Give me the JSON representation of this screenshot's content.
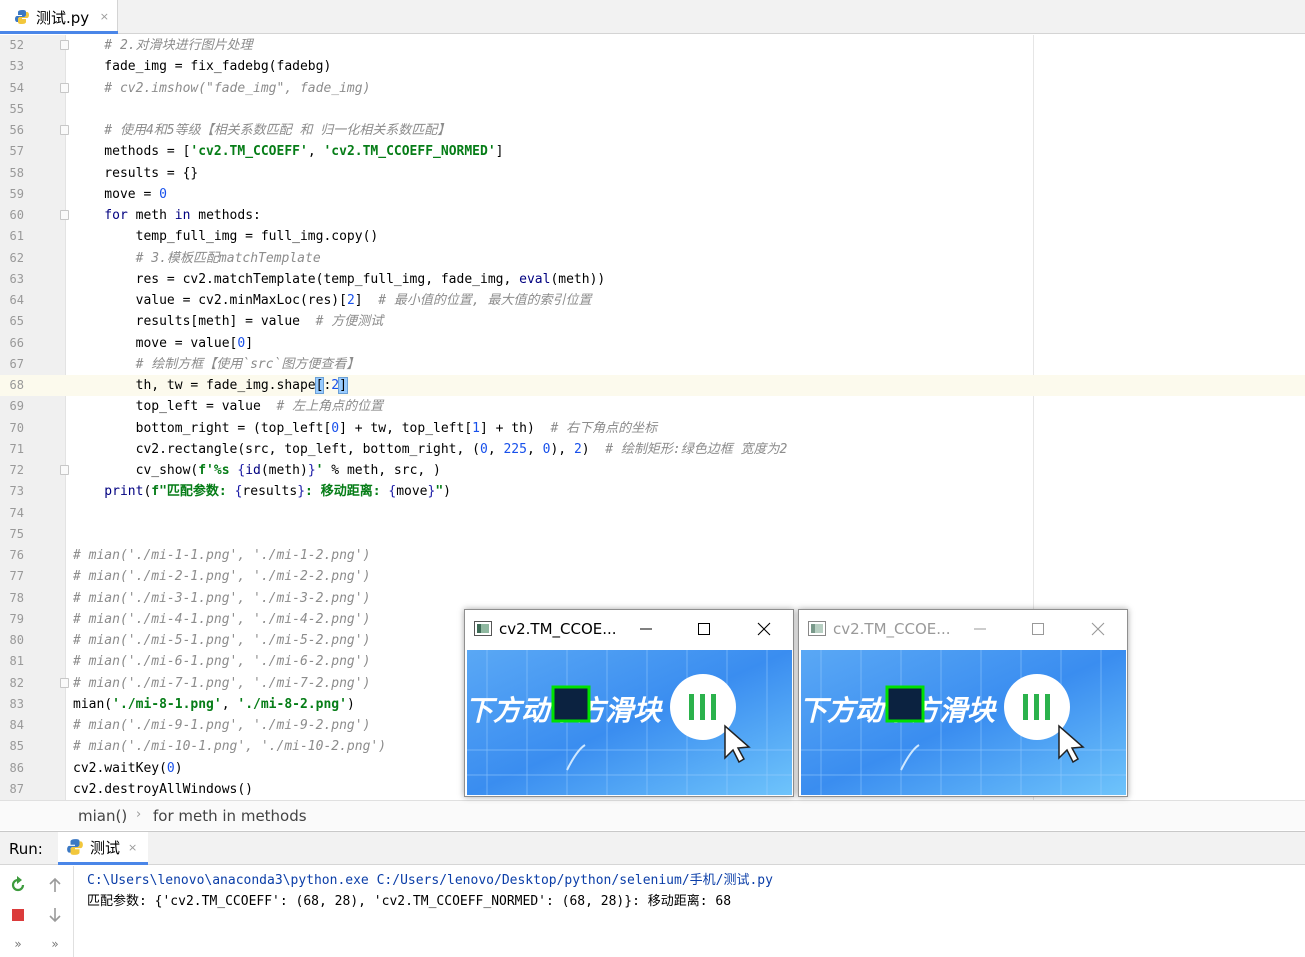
{
  "editor_tab": {
    "label": "测试.py",
    "close": "×"
  },
  "code_lines": [
    {
      "n": "52",
      "segs": [
        [
          "cmt",
          "    # 2.对滑块进行图片处理"
        ]
      ]
    },
    {
      "n": "53",
      "segs": [
        [
          "",
          "    fade_img = fix_fadebg(fadebg)"
        ]
      ]
    },
    {
      "n": "54",
      "segs": [
        [
          "cmt",
          "    # cv2.imshow(\"fade_img\", fade_img)"
        ]
      ]
    },
    {
      "n": "55",
      "segs": [
        [
          "",
          ""
        ]
      ]
    },
    {
      "n": "56",
      "segs": [
        [
          "cmt",
          "    # 使用4和5等级【相关系数匹配 和 归一化相关系数匹配】"
        ]
      ]
    },
    {
      "n": "57",
      "segs": [
        [
          "",
          "    methods = ["
        ],
        [
          "str",
          "'cv2.TM_CCOEFF'"
        ],
        [
          "",
          ", "
        ],
        [
          "str",
          "'cv2.TM_CCOEFF_NORMED'"
        ],
        [
          "",
          "]"
        ]
      ]
    },
    {
      "n": "58",
      "segs": [
        [
          "",
          "    results = {}"
        ]
      ]
    },
    {
      "n": "59",
      "segs": [
        [
          "",
          "    move = "
        ],
        [
          "num",
          "0"
        ]
      ]
    },
    {
      "n": "60",
      "segs": [
        [
          "kw",
          "    for"
        ],
        [
          "",
          " meth "
        ],
        [
          "kw",
          "in"
        ],
        [
          "",
          " methods:"
        ]
      ]
    },
    {
      "n": "61",
      "segs": [
        [
          "",
          "        temp_full_img = full_img.copy()"
        ]
      ]
    },
    {
      "n": "62",
      "segs": [
        [
          "cmt",
          "        # 3.模板匹配matchTemplate"
        ]
      ]
    },
    {
      "n": "63",
      "segs": [
        [
          "",
          "        res = cv2.matchTemplate(temp_full_img, fade_img, "
        ],
        [
          "bi",
          "eval"
        ],
        [
          "",
          "(meth))"
        ]
      ]
    },
    {
      "n": "64",
      "segs": [
        [
          "",
          "        value = cv2.minMaxLoc(res)["
        ],
        [
          "num",
          "2"
        ],
        [
          "",
          "]  "
        ],
        [
          "cmt",
          "# 最小值的位置, 最大值的索引位置"
        ]
      ]
    },
    {
      "n": "65",
      "segs": [
        [
          "",
          "        results[meth] = value  "
        ],
        [
          "cmt",
          "# 方便测试"
        ]
      ]
    },
    {
      "n": "66",
      "segs": [
        [
          "",
          "        move = value["
        ],
        [
          "num",
          "0"
        ],
        [
          "",
          "]"
        ]
      ]
    },
    {
      "n": "67",
      "segs": [
        [
          "cmt",
          "        # 绘制方框【使用`src`图方便查看】"
        ]
      ]
    },
    {
      "n": "68",
      "segs": [
        [
          "",
          "        th, tw = fade_img.shape"
        ],
        [
          "match",
          "["
        ],
        [
          "",
          ":"
        ],
        [
          "num",
          "2"
        ],
        [
          "match",
          "]"
        ]
      ],
      "current": true
    },
    {
      "n": "69",
      "segs": [
        [
          "",
          "        top_left = value  "
        ],
        [
          "cmt",
          "# 左上角点的位置"
        ]
      ]
    },
    {
      "n": "70",
      "segs": [
        [
          "",
          "        bottom_right = (top_left["
        ],
        [
          "num",
          "0"
        ],
        [
          "",
          "] + tw, top_left["
        ],
        [
          "num",
          "1"
        ],
        [
          "",
          "] + th)  "
        ],
        [
          "cmt",
          "# 右下角点的坐标"
        ]
      ]
    },
    {
      "n": "71",
      "segs": [
        [
          "",
          "        cv2.rectangle(src, top_left, bottom_right, ("
        ],
        [
          "num",
          "0"
        ],
        [
          "",
          ", "
        ],
        [
          "num",
          "225"
        ],
        [
          "",
          ", "
        ],
        [
          "num",
          "0"
        ],
        [
          "",
          "), "
        ],
        [
          "num",
          "2"
        ],
        [
          "",
          ")  "
        ],
        [
          "cmt",
          "# 绘制矩形:绿色边框 宽度为2"
        ]
      ]
    },
    {
      "n": "72",
      "segs": [
        [
          "",
          "        cv_show("
        ],
        [
          "fstr",
          "f'%s "
        ],
        [
          "brace",
          "{"
        ],
        [
          "bi",
          "id"
        ],
        [
          "",
          "(meth)"
        ],
        [
          "brace",
          "}"
        ],
        [
          "fstr",
          "'"
        ],
        [
          "",
          " % meth, src, )"
        ]
      ]
    },
    {
      "n": "73",
      "segs": [
        [
          "bi",
          "    print"
        ],
        [
          "",
          "("
        ],
        [
          "fstr",
          "f\"匹配参数: "
        ],
        [
          "brace",
          "{"
        ],
        [
          "",
          "results"
        ],
        [
          "brace",
          "}"
        ],
        [
          "fstr",
          ": 移动距离: "
        ],
        [
          "brace",
          "{"
        ],
        [
          "",
          "move"
        ],
        [
          "brace",
          "}"
        ],
        [
          "fstr",
          "\""
        ],
        [
          "",
          ")"
        ]
      ]
    },
    {
      "n": "74",
      "segs": [
        [
          "",
          ""
        ]
      ]
    },
    {
      "n": "75",
      "segs": [
        [
          "",
          ""
        ]
      ]
    },
    {
      "n": "76",
      "segs": [
        [
          "cmt",
          "# mian('./mi-1-1.png', './mi-1-2.png')"
        ]
      ]
    },
    {
      "n": "77",
      "segs": [
        [
          "cmt",
          "# mian('./mi-2-1.png', './mi-2-2.png')"
        ]
      ]
    },
    {
      "n": "78",
      "segs": [
        [
          "cmt",
          "# mian('./mi-3-1.png', './mi-3-2.png')"
        ]
      ]
    },
    {
      "n": "79",
      "segs": [
        [
          "cmt",
          "# mian('./mi-4-1.png', './mi-4-2.png')"
        ]
      ]
    },
    {
      "n": "80",
      "segs": [
        [
          "cmt",
          "# mian('./mi-5-1.png', './mi-5-2.png')"
        ]
      ]
    },
    {
      "n": "81",
      "segs": [
        [
          "cmt",
          "# mian('./mi-6-1.png', './mi-6-2.png')"
        ]
      ]
    },
    {
      "n": "82",
      "segs": [
        [
          "cmt",
          "# mian('./mi-7-1.png', './mi-7-2.png')"
        ]
      ]
    },
    {
      "n": "83",
      "segs": [
        [
          "",
          "mian("
        ],
        [
          "str",
          "'./mi-8-1.png'"
        ],
        [
          "",
          ", "
        ],
        [
          "str",
          "'./mi-8-2.png'"
        ],
        [
          "",
          ")"
        ]
      ]
    },
    {
      "n": "84",
      "segs": [
        [
          "cmt",
          "# mian('./mi-9-1.png', './mi-9-2.png')"
        ]
      ]
    },
    {
      "n": "85",
      "segs": [
        [
          "cmt",
          "# mian('./mi-10-1.png', './mi-10-2.png')"
        ]
      ]
    },
    {
      "n": "86",
      "segs": [
        [
          "",
          "cv2.waitKey("
        ],
        [
          "num",
          "0"
        ],
        [
          "",
          ")"
        ]
      ]
    },
    {
      "n": "87",
      "segs": [
        [
          "",
          "cv2.destroyAllWindows()"
        ]
      ]
    }
  ],
  "breadcrumb": {
    "items": [
      "mian()",
      "for meth in methods"
    ],
    "separator": "›"
  },
  "run_panel": {
    "title": "Run:",
    "tab_label": "测试",
    "tab_close": "×",
    "console": [
      "C:\\Users\\lenovo\\anaconda3\\python.exe C:/Users/lenovo/Desktop/python/selenium/手机/测试.py",
      "匹配参数: {'cv2.TM_CCOEFF': (68, 28), 'cv2.TM_CCOEFF_NORMED': (68, 28)}: 移动距离: 68"
    ],
    "tools": [
      "rerun-icon",
      "stop-icon",
      "up-arrow-icon",
      "down-arrow-icon",
      "more-icon"
    ]
  },
  "cv_windows": [
    {
      "title": "cv2.TM_CCOE...",
      "active": true,
      "image_text": "下方动下方滑块"
    },
    {
      "title": "cv2.TM_CCOE...",
      "active": false,
      "image_text": "下方动下方滑块"
    }
  ],
  "colors": {
    "accent": "#4a86e8",
    "match_box": "#00e100",
    "slider_bg": "#3a8df0",
    "slider_knob_icon": "#2bb24c"
  }
}
